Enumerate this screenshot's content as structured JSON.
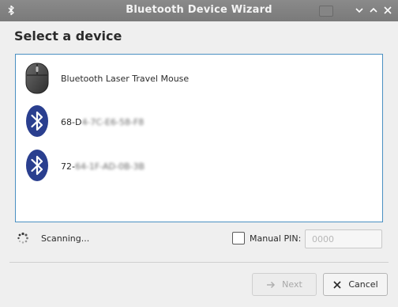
{
  "window": {
    "title": "Bluetooth Device Wizard",
    "app_icon": "bluetooth-icon",
    "controls": [
      "minimize-icon",
      "maximize-icon",
      "close-icon"
    ]
  },
  "heading": "Select a device",
  "devices": [
    {
      "label": "Bluetooth Laser Travel Mouse",
      "icon": "mouse-icon",
      "obscured": false
    },
    {
      "label_visible": "68-D",
      "label_obscured": "4-7C-E6-58-F8",
      "icon": "bluetooth-icon",
      "obscured": true
    },
    {
      "label_visible": "72-",
      "label_obscured": "64-1F-AD-0B-3B",
      "icon": "bluetooth-icon",
      "obscured": true
    }
  ],
  "status": {
    "text": "Scanning...",
    "icon": "spinner-icon"
  },
  "manual_pin": {
    "label": "Manual PIN:",
    "checked": false,
    "placeholder": "0000",
    "value": ""
  },
  "buttons": {
    "next": {
      "label": "Next",
      "icon": "arrow-right-icon",
      "enabled": false
    },
    "cancel": {
      "label": "Cancel",
      "icon": "close-icon",
      "enabled": true
    }
  },
  "colors": {
    "titlebar": "#7e7e7e",
    "bluetooth_badge": "#2a3f8f",
    "list_border": "#4a90c2"
  }
}
